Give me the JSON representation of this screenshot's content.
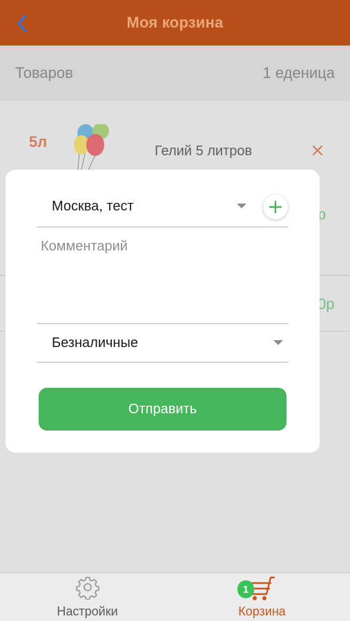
{
  "nav": {
    "title": "Моя корзина",
    "back_icon": "chevron-left-icon"
  },
  "summary": {
    "label": "Товаров",
    "count": "1 еденица"
  },
  "cart": {
    "item": {
      "image_badge": "5л",
      "name": "Гелий 5 литров",
      "remove_icon": "close-icon",
      "price_fragment": "р",
      "total_fragment": "0р"
    }
  },
  "modal": {
    "address_value": "Москва, тест",
    "add_icon": "plus-icon",
    "comment_placeholder": "Комментарий",
    "payment_value": "Безналичные",
    "submit_label": "Отправить"
  },
  "tabs": [
    {
      "label": "Настройки",
      "icon": "gear-icon",
      "active": false
    },
    {
      "label": "Корзина",
      "icon": "cart-icon",
      "active": true,
      "badge": "1"
    }
  ],
  "colors": {
    "nav_bg": "#b84f1a",
    "nav_title": "#e9a77e",
    "accent_green": "#47b55c",
    "active_tab": "#c9551c",
    "inactive_tab": "#5a5a5a"
  }
}
